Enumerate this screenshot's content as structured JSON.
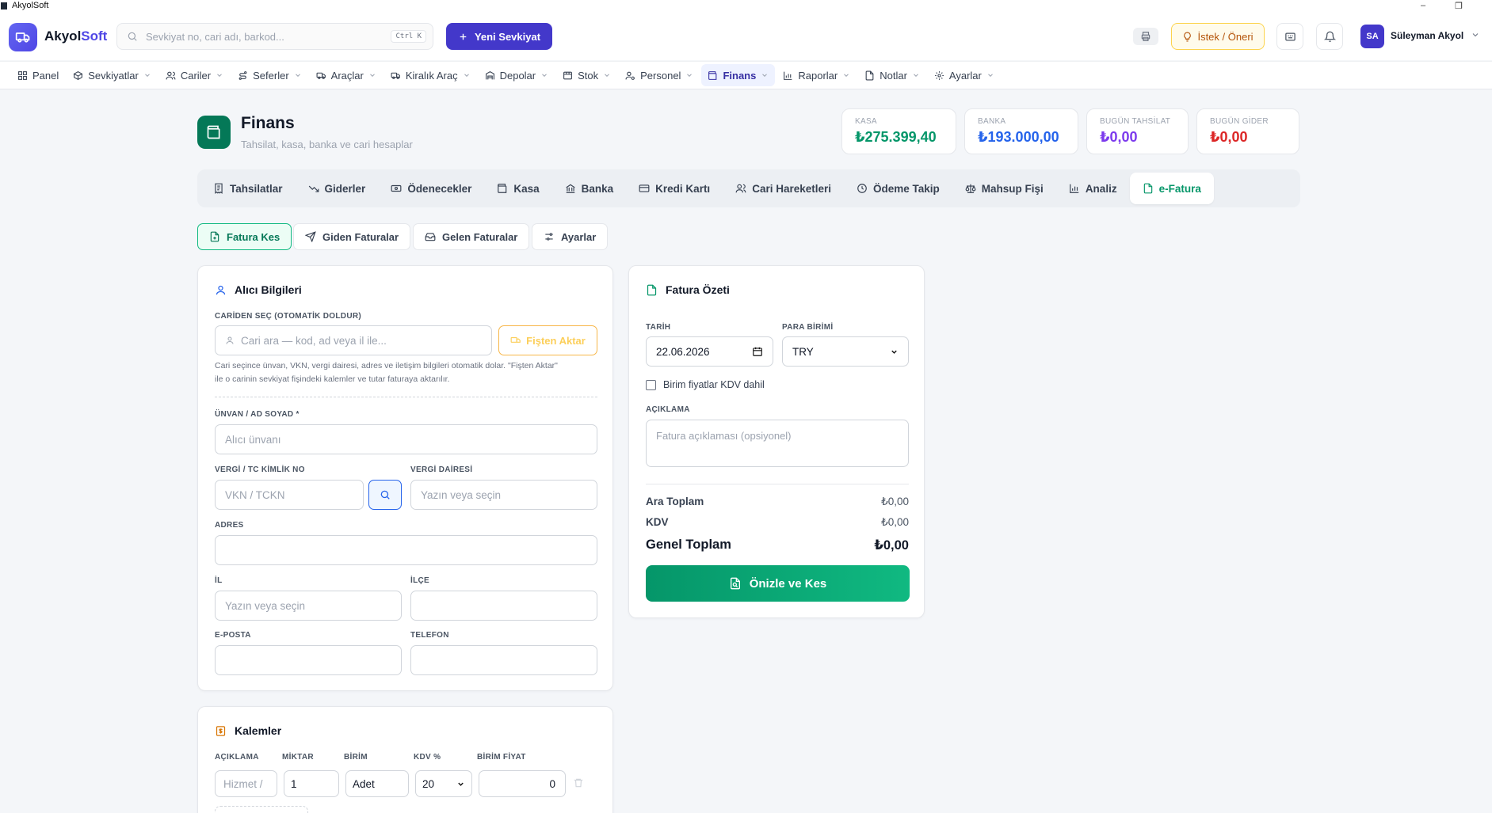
{
  "window": {
    "title": "AkyolSoft"
  },
  "header": {
    "brand_part1": "Akyol",
    "brand_part2": "Soft",
    "search_placeholder": "Sevkiyat no, cari adı, barkod...",
    "search_shortcut": "Ctrl K",
    "new_shipment_label": "Yeni Sevkiyat",
    "suggestion_label": "İstek / Öneri",
    "user_initials": "SA",
    "user_name": "Süleyman Akyol"
  },
  "nav": {
    "items": [
      {
        "label": "Panel",
        "icon": "grid-icon",
        "has_dropdown": false
      },
      {
        "label": "Sevkiyatlar",
        "icon": "box-icon",
        "has_dropdown": true
      },
      {
        "label": "Cariler",
        "icon": "users-icon",
        "has_dropdown": true
      },
      {
        "label": "Seferler",
        "icon": "route-icon",
        "has_dropdown": true
      },
      {
        "label": "Araçlar",
        "icon": "truck-icon",
        "has_dropdown": true
      },
      {
        "label": "Kiralık Araç",
        "icon": "truck-icon",
        "has_dropdown": true
      },
      {
        "label": "Depolar",
        "icon": "warehouse-icon",
        "has_dropdown": true
      },
      {
        "label": "Stok",
        "icon": "stock-icon",
        "has_dropdown": true
      },
      {
        "label": "Personel",
        "icon": "user-cog-icon",
        "has_dropdown": true
      },
      {
        "label": "Finans",
        "icon": "wallet-icon",
        "has_dropdown": true,
        "active": true
      },
      {
        "label": "Raporlar",
        "icon": "bar-chart-icon",
        "has_dropdown": true
      },
      {
        "label": "Notlar",
        "icon": "file-icon",
        "has_dropdown": true
      },
      {
        "label": "Ayarlar",
        "icon": "gear-icon",
        "has_dropdown": true
      }
    ]
  },
  "page": {
    "title": "Finans",
    "subtitle": "Tahsilat, kasa, banka ve cari hesaplar"
  },
  "stats": [
    {
      "label": "KASA",
      "value": "₺275.399,40",
      "color": "#059669"
    },
    {
      "label": "BANKA",
      "value": "₺193.000,00",
      "color": "#2563eb"
    },
    {
      "label": "BUGÜN TAHSİLAT",
      "value": "₺0,00",
      "color": "#7c3aed"
    },
    {
      "label": "BUGÜN GİDER",
      "value": "₺0,00",
      "color": "#dc2626"
    }
  ],
  "tabs": [
    {
      "label": "Tahsilatlar",
      "icon": "receipt-icon"
    },
    {
      "label": "Giderler",
      "icon": "trend-down-icon"
    },
    {
      "label": "Ödenecekler",
      "icon": "banknote-icon"
    },
    {
      "label": "Kasa",
      "icon": "wallet-icon"
    },
    {
      "label": "Banka",
      "icon": "bank-icon"
    },
    {
      "label": "Kredi Kartı",
      "icon": "credit-card-icon"
    },
    {
      "label": "Cari Hareketleri",
      "icon": "users-icon"
    },
    {
      "label": "Ödeme Takip",
      "icon": "clock-icon"
    },
    {
      "label": "Mahsup Fişi",
      "icon": "scale-icon"
    },
    {
      "label": "Analiz",
      "icon": "bar-chart-icon"
    },
    {
      "label": "e-Fatura",
      "icon": "file-icon",
      "active": true
    }
  ],
  "subtabs": [
    {
      "label": "Fatura Kes",
      "icon": "file-plus-icon",
      "active": true
    },
    {
      "label": "Giden Faturalar",
      "icon": "send-icon"
    },
    {
      "label": "Gelen Faturalar",
      "icon": "inbox-icon"
    },
    {
      "label": "Ayarlar",
      "icon": "sliders-icon"
    }
  ],
  "recipient": {
    "title": "Alıcı Bilgileri",
    "select_label": "CARİDEN SEÇ (OTOMATİK DOLDUR)",
    "select_placeholder": "Cari ara — kod, ad veya il ile...",
    "import_button": "Fişten Aktar",
    "hint_line1": "Cari seçince ünvan, VKN, vergi dairesi, adres ve iletişim bilgileri otomatik dolar. \"Fişten Aktar\"",
    "hint_line2": "ile o carinin sevkiyat fişindeki kalemler ve tutar faturaya aktarılır.",
    "name_label": "ÜNVAN / AD SOYAD *",
    "name_placeholder": "Alıcı ünvanı",
    "tax_no_label": "VERGİ / TC KİMLİK NO",
    "tax_no_placeholder": "VKN / TCKN",
    "tax_office_label": "VERGİ DAİRESİ",
    "tax_office_placeholder": "Yazın veya seçin",
    "address_label": "ADRES",
    "address_value": "",
    "city_label": "İL",
    "city_placeholder": "Yazın veya seçin",
    "district_label": "İLÇE",
    "district_value": "",
    "email_label": "E-POSTA",
    "email_value": "",
    "phone_label": "TELEFON",
    "phone_value": ""
  },
  "items": {
    "title": "Kalemler",
    "headers": [
      "AÇIKLAMA",
      "MİKTAR",
      "BİRİM",
      "KDV %",
      "BİRİM FİYAT"
    ],
    "row": {
      "description_placeholder": "Hizmet /",
      "quantity": "1",
      "unit": "Adet",
      "vat": "20",
      "unit_price": "0"
    }
  },
  "summary": {
    "title": "Fatura Özeti",
    "date_label": "TARİH",
    "date_value": "22.06.2026",
    "currency_label": "PARA BİRİMİ",
    "currency_value": "TRY",
    "vat_included_label": "Birim fiyatlar KDV dahil",
    "vat_included_checked": false,
    "description_label": "AÇIKLAMA",
    "description_placeholder": "Fatura açıklaması (opsiyonel)",
    "subtotal_label": "Ara Toplam",
    "subtotal_value": "₺0,00",
    "vat_label": "KDV",
    "vat_value": "₺0,00",
    "total_label": "Genel Toplam",
    "total_value": "₺0,00",
    "submit_label": "Önizle ve Kes"
  },
  "colors": {
    "brand": "#4f46e5",
    "accent_green": "#059669",
    "nav_active_bg": "#eef2ff"
  }
}
